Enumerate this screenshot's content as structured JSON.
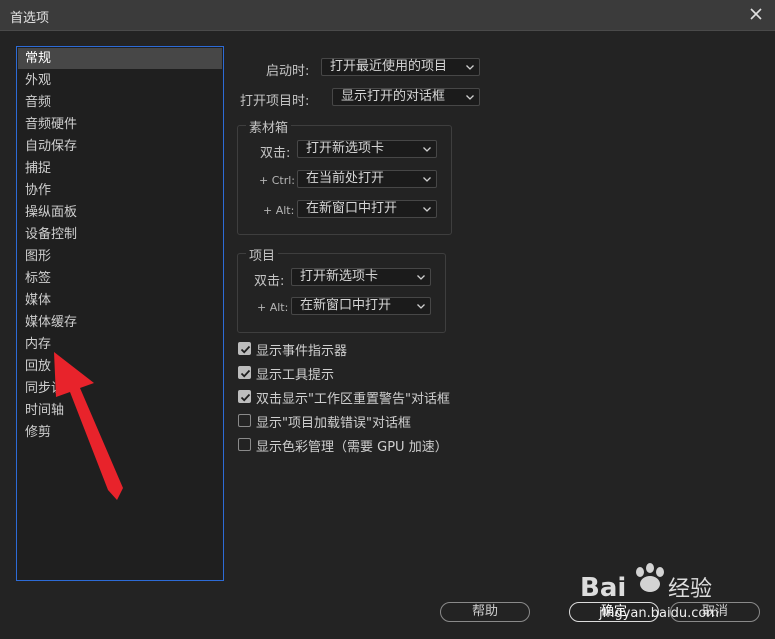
{
  "window": {
    "title": "首选项"
  },
  "sidebar": {
    "items": [
      {
        "label": "常规"
      },
      {
        "label": "外观"
      },
      {
        "label": "音频"
      },
      {
        "label": "音频硬件"
      },
      {
        "label": "自动保存"
      },
      {
        "label": "捕捉"
      },
      {
        "label": "协作"
      },
      {
        "label": "操纵面板"
      },
      {
        "label": "设备控制"
      },
      {
        "label": "图形"
      },
      {
        "label": "标签"
      },
      {
        "label": "媒体"
      },
      {
        "label": "媒体缓存"
      },
      {
        "label": "内存"
      },
      {
        "label": "回放"
      },
      {
        "label": "同步设"
      },
      {
        "label": "时间轴"
      },
      {
        "label": "修剪"
      }
    ],
    "selected_index": 0
  },
  "general": {
    "startup_label": "启动时:",
    "startup_value": "打开最近使用的项目",
    "open_project_label": "打开项目时:",
    "open_project_value": "显示打开的对话框"
  },
  "bin_group": {
    "title": "素材箱",
    "double_click_label": "双击:",
    "double_click_value": "打开新选项卡",
    "ctrl_label": "+ Ctrl:",
    "ctrl_value": "在当前处打开",
    "alt_label": "+ Alt:",
    "alt_value": "在新窗口中打开"
  },
  "project_group": {
    "title": "项目",
    "double_click_label": "双击:",
    "double_click_value": "打开新选项卡",
    "alt_label": "+ Alt:",
    "alt_value": "在新窗口中打开"
  },
  "checkboxes": [
    {
      "label": "显示事件指示器",
      "checked": true
    },
    {
      "label": "显示工具提示",
      "checked": true
    },
    {
      "label": "双击显示\"工作区重置警告\"对话框",
      "checked": true
    },
    {
      "label": "显示\"项目加载错误\"对话框",
      "checked": false
    },
    {
      "label": "显示色彩管理（需要 GPU 加速）",
      "checked": false
    }
  ],
  "buttons": {
    "help": "帮助",
    "ok": "确定",
    "cancel": "取消"
  },
  "watermark": {
    "logo_text": "Baidu经验",
    "url": "jingyan.baidu.com"
  },
  "colors": {
    "accent": "#2d6bd6",
    "arrow": "#e8232b",
    "selected_item": "#474747"
  }
}
